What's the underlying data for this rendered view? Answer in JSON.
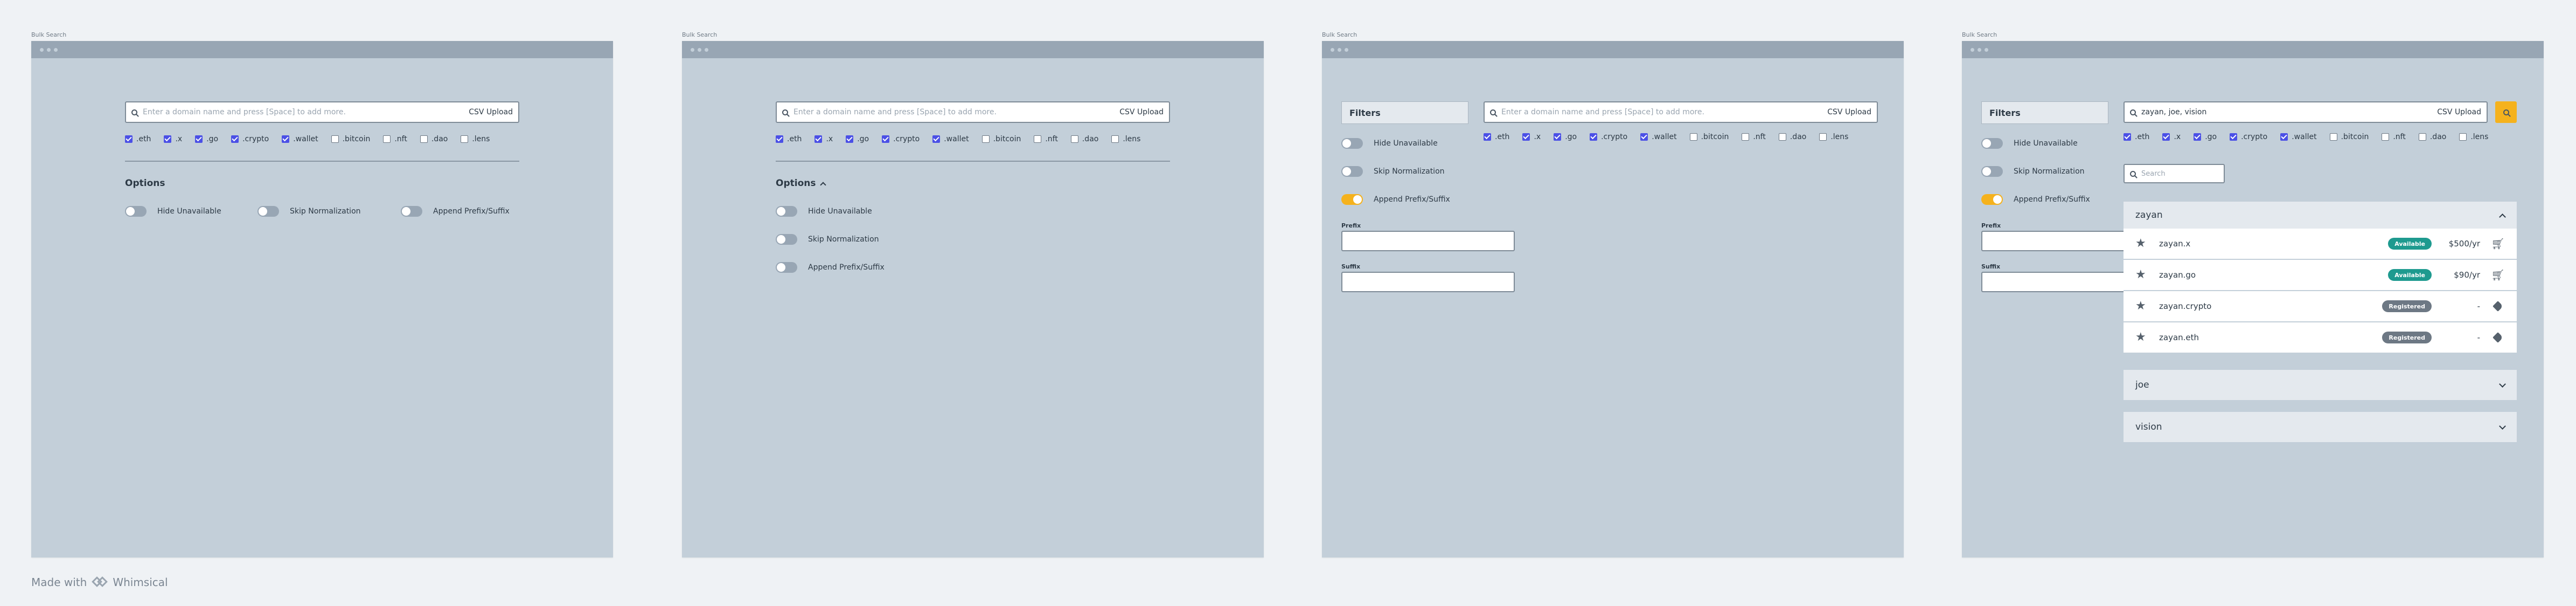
{
  "frames": [
    {
      "label": "Bulk Search"
    },
    {
      "label": "Bulk Search"
    },
    {
      "label": "Bulk Search"
    },
    {
      "label": "Bulk Search"
    }
  ],
  "search": {
    "placeholder": "Enter a domain name and press [Space] to add more.",
    "csv_label": "CSV Upload",
    "filled_value": "zayan, joe, vision"
  },
  "tlds": [
    {
      "label": ".eth",
      "checked": true
    },
    {
      "label": ".x",
      "checked": true
    },
    {
      "label": ".go",
      "checked": true
    },
    {
      "label": ".crypto",
      "checked": true
    },
    {
      "label": ".wallet",
      "checked": true
    },
    {
      "label": ".bitcoin",
      "checked": false
    },
    {
      "label": ".nft",
      "checked": false
    },
    {
      "label": ".dao",
      "checked": false
    },
    {
      "label": ".lens",
      "checked": false
    }
  ],
  "options": {
    "title": "Options",
    "hide_unavailable": "Hide Unavailable",
    "skip_normalization": "Skip Normalization",
    "append_prefix_suffix": "Append Prefix/Suffix"
  },
  "filters": {
    "title": "Filters",
    "prefix_label": "Prefix",
    "suffix_label": "Suffix"
  },
  "results": {
    "search_placeholder": "Search",
    "groups": [
      {
        "name": "zayan",
        "expanded": true,
        "rows": [
          {
            "domain": "zayan.x",
            "status": "Available",
            "price": "$500/yr",
            "action_icon": "cart-icon"
          },
          {
            "domain": "zayan.go",
            "status": "Available",
            "price": "$90/yr",
            "action_icon": "cart-icon"
          },
          {
            "domain": "zayan.crypto",
            "status": "Registered",
            "price": "-",
            "action_icon": "tag-icon"
          },
          {
            "domain": "zayan.eth",
            "status": "Registered",
            "price": "-",
            "action_icon": "tag-icon"
          }
        ]
      },
      {
        "name": "joe",
        "expanded": false
      },
      {
        "name": "vision",
        "expanded": false
      }
    ]
  },
  "footer": {
    "made_with": "Made with",
    "brand": "Whimsical"
  },
  "colors": {
    "canvas": "#eff2f5",
    "frame": "#c3cfd9",
    "checkbox_accent": "#4b50e6",
    "toggle_on": "#f5b21d",
    "available": "#1e9a8f",
    "registered": "#6d7884"
  }
}
